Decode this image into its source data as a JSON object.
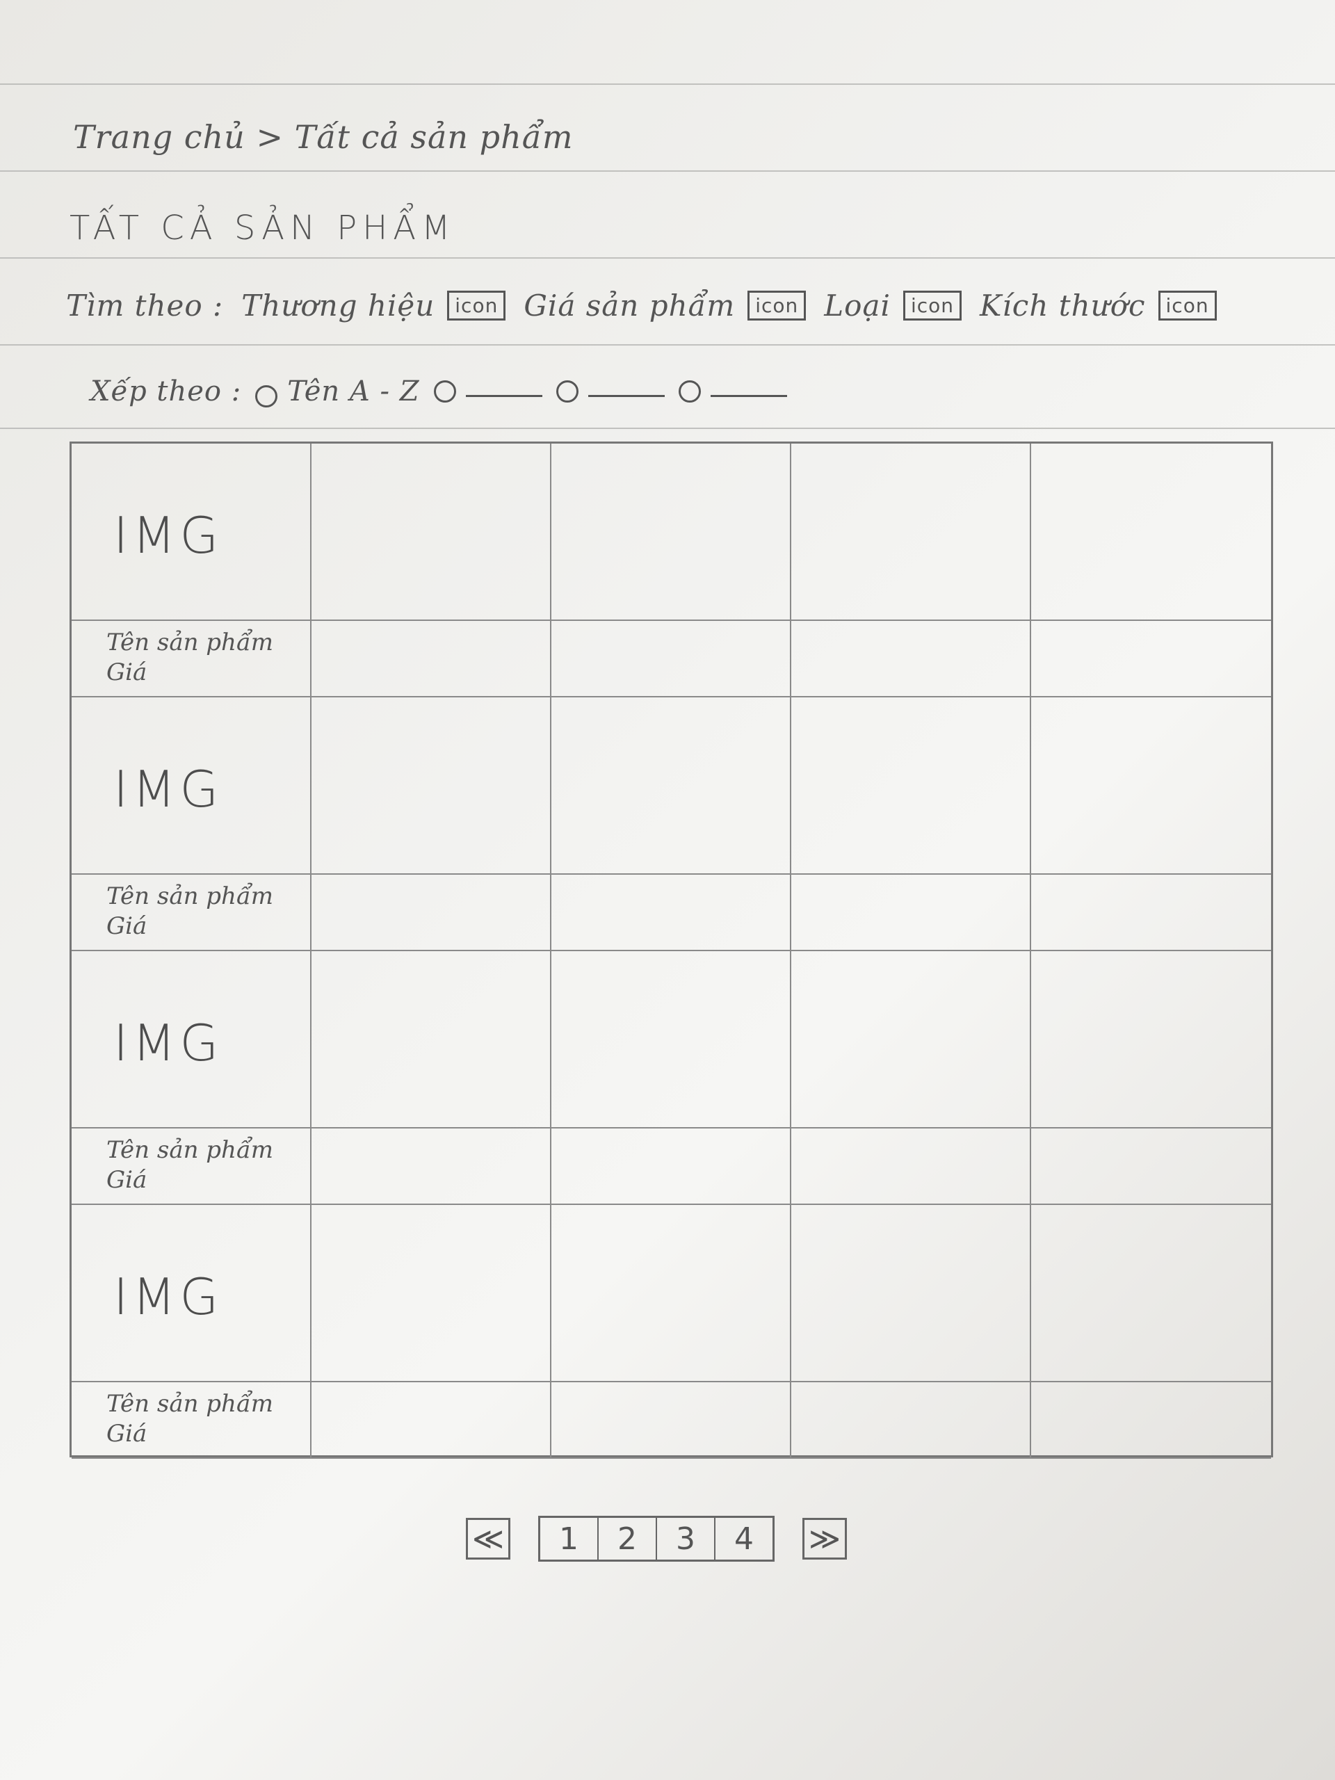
{
  "breadcrumb": {
    "home": "Trang chủ",
    "separator": ">",
    "current": "Tất cả sản phẩm"
  },
  "page_title": "TẤT CẢ SẢN PHẨM",
  "filter": {
    "label": "Tìm theo :",
    "options": [
      {
        "label": "Thương hiệu",
        "icon_text": "icon"
      },
      {
        "label": "Giá sản phẩm",
        "icon_text": "icon"
      },
      {
        "label": "Loại",
        "icon_text": "icon"
      },
      {
        "label": "Kích thước",
        "icon_text": "icon"
      }
    ]
  },
  "sort": {
    "label": "Xếp theo :",
    "options": [
      {
        "label": "Tên A - Z"
      },
      {
        "label": ""
      },
      {
        "label": ""
      },
      {
        "label": ""
      }
    ]
  },
  "product_grid": {
    "rows": 4,
    "columns": 5,
    "img_label": "IMG",
    "name_label": "Tên sản phẩm",
    "price_label": "Giá"
  },
  "pagination": {
    "prev": "≪",
    "pages": [
      "1",
      "2",
      "3",
      "4"
    ],
    "next": "≫"
  }
}
